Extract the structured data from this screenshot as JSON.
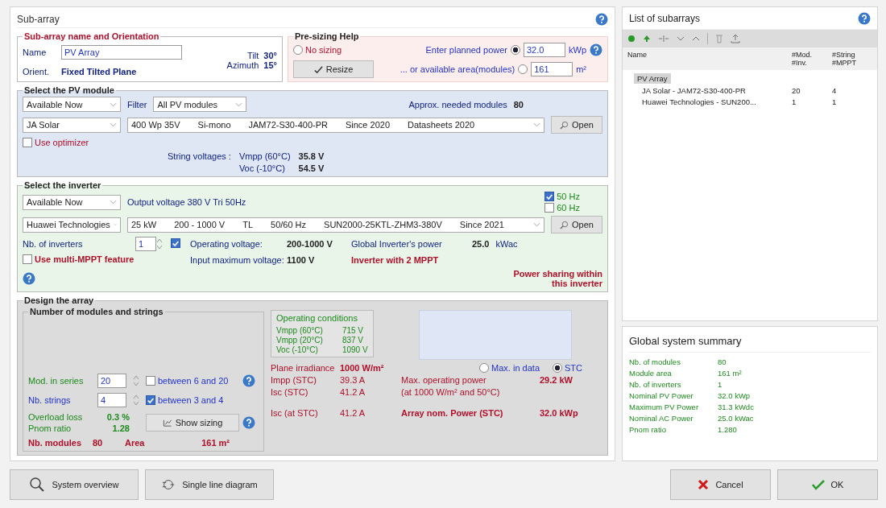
{
  "title": "Sub-array",
  "name_orientation": {
    "legend": "Sub-array name and Orientation",
    "name_label": "Name",
    "name_value": "PV Array",
    "orient_label": "Orient.",
    "orient_value": "Fixed Tilted Plane",
    "tilt_label": "Tilt",
    "tilt_value": "30°",
    "azimuth_label": "Azimuth",
    "azimuth_value": "15°"
  },
  "presizing": {
    "legend": "Pre-sizing Help",
    "no_sizing": {
      "label": "No sizing",
      "selected": false
    },
    "resize_button": "Resize",
    "power": {
      "label": "Enter planned power",
      "selected": true,
      "value": "32.0",
      "unit": "kWp"
    },
    "area": {
      "label": "... or available area(modules)",
      "selected": false,
      "value": "161",
      "unit": "m²"
    }
  },
  "module": {
    "legend": "Select the PV module",
    "availability": "Available Now",
    "filter_label": "Filter",
    "filter": "All PV modules",
    "needed_label": "Approx. needed modules",
    "needed_value": "80",
    "manufacturer": "JA Solar",
    "model": [
      "400 Wp 35V",
      "Si-mono",
      "JAM72-S30-400-PR",
      "Since 2020",
      "Datasheets 2020"
    ],
    "open_button": "Open",
    "optimizer": {
      "label": "Use optimizer",
      "checked": false
    },
    "string_label": "String voltages :",
    "voltages": [
      {
        "label": "Vmpp (60°C)",
        "value": "35.8 V"
      },
      {
        "label": "Voc (-10°C)",
        "value": "54.5 V"
      }
    ]
  },
  "inverter": {
    "legend": "Select the inverter",
    "availability": "Available Now",
    "output_voltage": "Output voltage 380 V Tri 50Hz",
    "frequencies": [
      {
        "label": "50 Hz",
        "checked": true
      },
      {
        "label": "60 Hz",
        "checked": false
      }
    ],
    "manufacturer": "Huawei Technologies",
    "model": [
      "25 kW",
      "200 - 1000 V",
      "TL",
      "50/60 Hz",
      "SUN2000-25KTL-ZHM3-380V",
      "Since 2021"
    ],
    "open_button": "Open",
    "count_label": "Nb. of inverters",
    "count_value": "1",
    "count_checked": true,
    "operating_label": "Operating voltage:",
    "operating_value": "200-1000 V",
    "global_label": "Global Inverter's power",
    "global_value": "25.0",
    "global_unit": "kWac",
    "multi_mppt": {
      "label": "Use multi-MPPT feature",
      "checked": false
    },
    "max_label": "Input maximum voltage:",
    "max_value": "1100 V",
    "mppt_note": "Inverter with 2 MPPT",
    "sharing_note": "Power sharing within this inverter"
  },
  "design": {
    "legend": "Design the array",
    "box_legend": "Number of modules and strings",
    "series": {
      "label": "Mod. in series",
      "value": "20",
      "range": "between 6 and 20",
      "checked": false
    },
    "strings": {
      "label": "Nb. strings",
      "value": "4",
      "range": "between 3 and 4",
      "checked": true
    },
    "overload_label": "Overload loss",
    "overload_value": "0.3 %",
    "ratio_label": "Pnom ratio",
    "ratio_value": "1.28",
    "show_button": "Show sizing",
    "modules_label": "Nb. modules",
    "modules_value": "80",
    "area_label": "Area",
    "area_value": "161 m²",
    "operating": {
      "title": "Operating conditions",
      "rows": [
        {
          "label": "Vmpp (60°C)",
          "value": "715 V"
        },
        {
          "label": "Vmpp (20°C)",
          "value": "837 V"
        },
        {
          "label": "Voc (-10°C)",
          "value": "1090 V"
        }
      ]
    },
    "irradiance_label": "Plane irradiance",
    "irradiance_value": "1000 W/m²",
    "modes": [
      {
        "label": "Max. in data",
        "selected": false
      },
      {
        "label": "STC",
        "selected": true
      }
    ],
    "currents": [
      {
        "label": "Impp (STC)",
        "value": "39.3 A"
      },
      {
        "label": "Isc (STC)",
        "value": "41.2 A"
      }
    ],
    "max_power_label": "Max. operating power",
    "max_power_value": "29.2 kW",
    "max_power_note": "(at 1000 W/m² and 50°C)",
    "isc_label": "Isc (at STC)",
    "isc_value": "41.2 A",
    "nom_label": "Array nom. Power (STC)",
    "nom_value": "32.0 kWp"
  },
  "subarrays": {
    "title": "List of subarrays",
    "columns": [
      "Name",
      "#Mod.\n#Inv.",
      "#String\n#MPPT"
    ],
    "tree": [
      {
        "name": "PV Array",
        "selected": true,
        "children": [
          {
            "name": "JA Solar - JAM72-S30-400-PR",
            "col_2": "20",
            "col_3": "4"
          },
          {
            "name": "Huawei Technologies - SUN200...",
            "col_2": "1",
            "col_3": "1"
          }
        ]
      }
    ]
  },
  "summary": {
    "title": "Global system summary",
    "rows": [
      {
        "label": "Nb. of modules",
        "value": "80"
      },
      {
        "label": "Module area",
        "value": "161 m²"
      },
      {
        "label": "Nb. of inverters",
        "value": "1"
      },
      {
        "label": "Nominal PV Power",
        "value": "32.0 kWp"
      },
      {
        "label": "Maximum PV Power",
        "value": "31.3 kWdc"
      },
      {
        "label": "Nominal AC Power",
        "value": "25.0 kWac"
      },
      {
        "label": "Pnom ratio",
        "value": "1.280"
      }
    ]
  },
  "buttons": {
    "overview": "System overview",
    "diagram": "Single line diagram",
    "cancel": "Cancel",
    "ok": "OK"
  }
}
